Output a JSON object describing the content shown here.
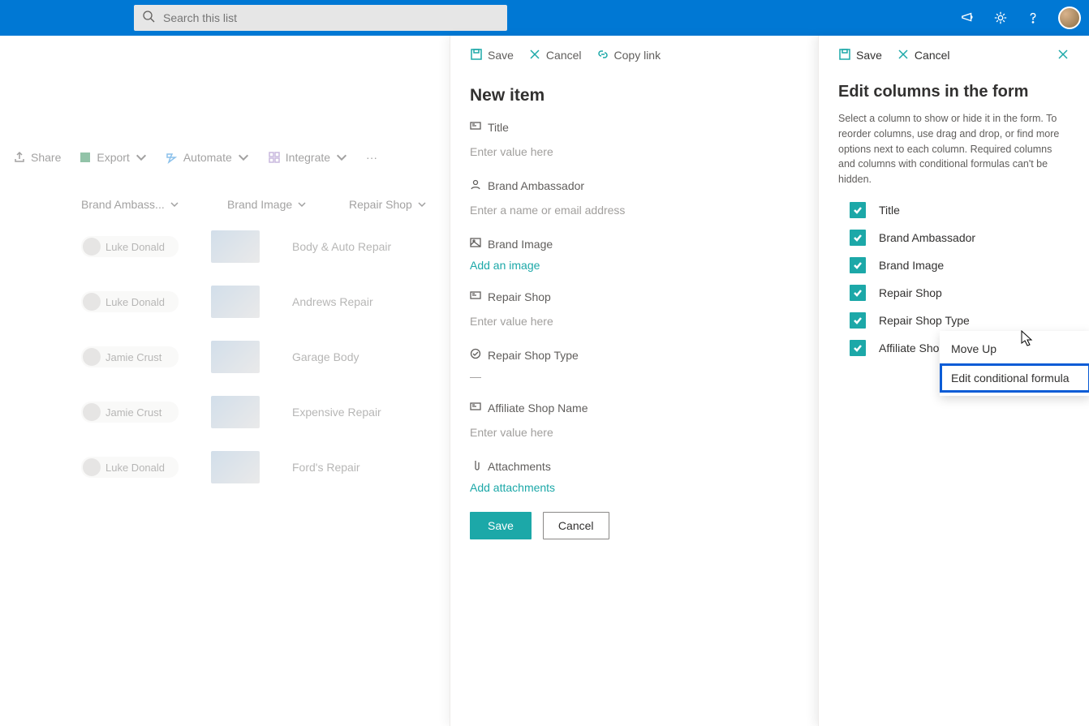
{
  "suite": {
    "search_placeholder": "Search this list"
  },
  "toolbar": {
    "share": "Share",
    "export": "Export",
    "automate": "Automate",
    "integrate": "Integrate"
  },
  "list": {
    "columns": {
      "ambassador": "Brand Ambass...",
      "image": "Brand Image",
      "repair": "Repair Shop"
    },
    "rows": [
      {
        "person": "Luke Donald",
        "repair": "Body & Auto Repair"
      },
      {
        "person": "Luke Donald",
        "repair": "Andrews Repair"
      },
      {
        "person": "Jamie Crust",
        "repair": "Garage Body"
      },
      {
        "person": "Jamie Crust",
        "repair": "Expensive Repair"
      },
      {
        "person": "Luke Donald",
        "repair": "Ford's Repair"
      }
    ]
  },
  "newItem": {
    "cmd_save": "Save",
    "cmd_cancel": "Cancel",
    "cmd_copylink": "Copy link",
    "title": "New item",
    "fields": {
      "title_label": "Title",
      "title_placeholder": "Enter value here",
      "ambassador_label": "Brand Ambassador",
      "ambassador_placeholder": "Enter a name or email address",
      "image_label": "Brand Image",
      "image_action": "Add an image",
      "repair_label": "Repair Shop",
      "repair_placeholder": "Enter value here",
      "type_label": "Repair Shop Type",
      "type_value": "—",
      "affiliate_label": "Affiliate Shop Name",
      "affiliate_placeholder": "Enter value here",
      "attach_label": "Attachments",
      "attach_action": "Add attachments"
    },
    "btn_save": "Save",
    "btn_cancel": "Cancel"
  },
  "editCols": {
    "cmd_save": "Save",
    "cmd_cancel": "Cancel",
    "title": "Edit columns in the form",
    "desc": "Select a column to show or hide it in the form. To reorder columns, use drag and drop, or find more options next to each column. Required columns and columns with conditional formulas can't be hidden.",
    "items": [
      "Title",
      "Brand Ambassador",
      "Brand Image",
      "Repair Shop",
      "Repair Shop Type",
      "Affiliate Shop Name"
    ],
    "ctx": {
      "move_up": "Move Up",
      "edit_formula": "Edit conditional formula"
    }
  },
  "colors": {
    "brand": "#0078d4",
    "teal": "#1ca8a8",
    "highlight": "#0b5cd6"
  }
}
